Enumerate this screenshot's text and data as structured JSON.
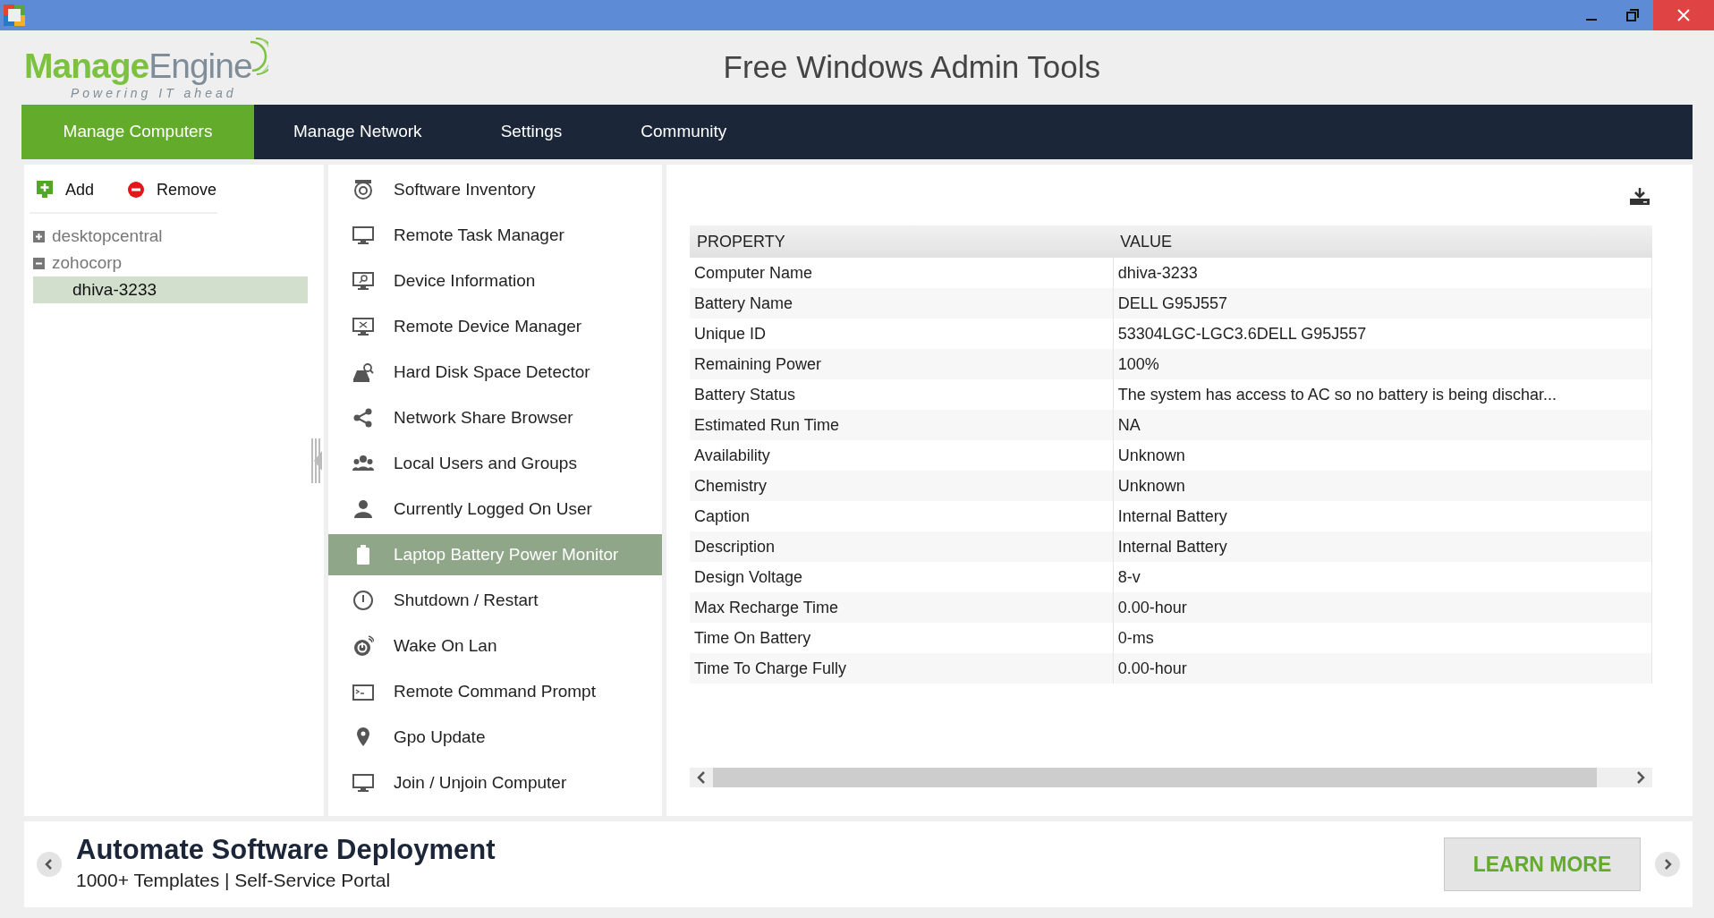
{
  "app": {
    "title": "Free Windows Admin Tools"
  },
  "logo": {
    "name_first": "Manage",
    "name_second": "Engine",
    "tagline": "Powering IT ahead"
  },
  "nav": [
    {
      "label": "Manage Computers",
      "selected": true
    },
    {
      "label": "Manage Network",
      "selected": false
    },
    {
      "label": "Settings",
      "selected": false
    },
    {
      "label": "Community",
      "selected": false
    }
  ],
  "toolbar": [
    {
      "kind": "add",
      "label": "Add"
    },
    {
      "kind": "remove",
      "label": "Remove"
    }
  ],
  "tree": [
    {
      "label": "desktopcentral",
      "expanded": false,
      "selected": false
    },
    {
      "label": "zohocorp",
      "expanded": true,
      "selected": false,
      "children": [
        {
          "label": "dhiva-3233",
          "selected": true
        }
      ]
    }
  ],
  "tools": [
    {
      "kind": "disc",
      "label": "Software Inventory",
      "selected": false
    },
    {
      "kind": "monitor",
      "label": "Remote Task Manager",
      "selected": false
    },
    {
      "kind": "monitor-search",
      "label": "Device Information",
      "selected": false
    },
    {
      "kind": "monitor-tools",
      "label": "Remote Device Manager",
      "selected": false
    },
    {
      "kind": "drive-search",
      "label": "Hard Disk Space Detector",
      "selected": false
    },
    {
      "kind": "share",
      "label": "Network Share Browser",
      "selected": false
    },
    {
      "kind": "users",
      "label": "Local Users and Groups",
      "selected": false
    },
    {
      "kind": "user",
      "label": "Currently Logged On User",
      "selected": false
    },
    {
      "kind": "battery",
      "label": "Laptop Battery Power Monitor",
      "selected": true
    },
    {
      "kind": "power",
      "label": "Shutdown / Restart",
      "selected": false
    },
    {
      "kind": "wake",
      "label": "Wake On Lan",
      "selected": false
    },
    {
      "kind": "terminal",
      "label": "Remote Command Prompt",
      "selected": false
    },
    {
      "kind": "pin",
      "label": "Gpo Update",
      "selected": false
    },
    {
      "kind": "monitor",
      "label": "Join / Unjoin Computer",
      "selected": false
    }
  ],
  "table": {
    "columns": [
      "PROPERTY",
      "VALUE"
    ],
    "rows": [
      [
        "Computer Name",
        "dhiva-3233"
      ],
      [
        "Battery Name",
        "DELL G95J557"
      ],
      [
        "Unique ID",
        "53304LGC-LGC3.6DELL G95J557"
      ],
      [
        "Remaining Power",
        "100%"
      ],
      [
        "Battery Status",
        "The system has access to AC so no battery is being dischar..."
      ],
      [
        "Estimated Run Time",
        "NA"
      ],
      [
        "Availability",
        "Unknown"
      ],
      [
        "Chemistry",
        "Unknown"
      ],
      [
        "Caption",
        "Internal Battery"
      ],
      [
        "Description",
        "Internal Battery"
      ],
      [
        "Design Voltage",
        "8-v"
      ],
      [
        "Max Recharge Time",
        "0.00-hour"
      ],
      [
        "Time On Battery",
        "0-ms"
      ],
      [
        "Time To Charge Fully",
        "0.00-hour"
      ]
    ]
  },
  "banner": {
    "title": "Automate Software Deployment",
    "subtitle": "1000+ Templates | Self-Service Portal",
    "button": "LEARN MORE"
  }
}
